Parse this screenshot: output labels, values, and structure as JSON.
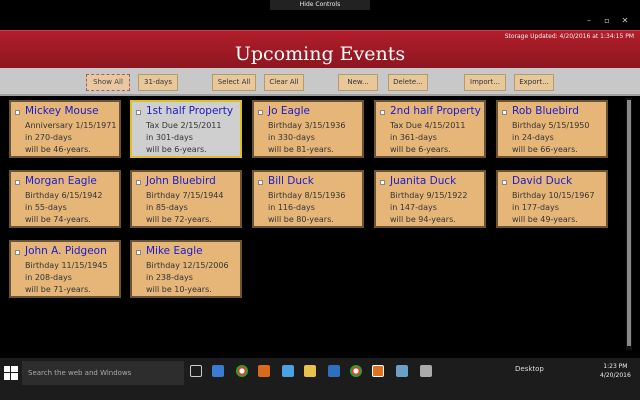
{
  "window": {
    "hide_controls": "Hide Controls",
    "storage_status": "Storage Updated: 4/20/2016 at 1:34:15 PM",
    "minimize": "–",
    "maximize": "▫",
    "close": "✕"
  },
  "header": {
    "title": "Upcoming Events"
  },
  "toolbar": {
    "show_all": "Show All",
    "days31": "31-days",
    "select_all": "Select All",
    "clear_all": "Clear All",
    "new": "New...",
    "delete": "Delete...",
    "import": "Import...",
    "export": "Export..."
  },
  "events": [
    {
      "name": "Mickey Mouse",
      "l1": "Anniversary 1/15/1971",
      "l2": "in 270-days",
      "l3": "will be 46-years."
    },
    {
      "name": "1st half Property",
      "l1": "Tax Due 2/15/2011",
      "l2": "in 301-days",
      "l3": "will be 6-years."
    },
    {
      "name": "Jo Eagle",
      "l1": "Birthday 3/15/1936",
      "l2": "in 330-days",
      "l3": "will be 81-years."
    },
    {
      "name": "2nd half Property",
      "l1": "Tax Due 4/15/2011",
      "l2": "in 361-days",
      "l3": "will be 6-years."
    },
    {
      "name": "Rob Bluebird",
      "l1": "Birthday 5/15/1950",
      "l2": "in 24-days",
      "l3": "will be 66-years."
    },
    {
      "name": "Morgan Eagle",
      "l1": "Birthday 6/15/1942",
      "l2": "in 55-days",
      "l3": "will be 74-years."
    },
    {
      "name": "John Bluebird",
      "l1": "Birthday 7/15/1944",
      "l2": "in 85-days",
      "l3": "will be 72-years."
    },
    {
      "name": "Bill Duck",
      "l1": "Birthday 8/15/1936",
      "l2": "in 116-days",
      "l3": "will be 80-years."
    },
    {
      "name": "Juanita Duck",
      "l1": "Birthday 9/15/1922",
      "l2": "in 147-days",
      "l3": "will be 94-years."
    },
    {
      "name": "David Duck",
      "l1": "Birthday 10/15/1967",
      "l2": "in 177-days",
      "l3": "will be 49-years."
    },
    {
      "name": "John A. Pidgeon",
      "l1": "Birthday 11/15/1945",
      "l2": "in 208-days",
      "l3": "will be 71-years."
    },
    {
      "name": "Mike Eagle",
      "l1": "Birthday 12/15/2006",
      "l2": "in 238-days",
      "l3": "will be 10-years."
    }
  ],
  "taskbar": {
    "search_placeholder": "Search the web and Windows",
    "desktop": "Desktop",
    "time": "1:23 PM",
    "date": "4/20/2016"
  },
  "colors": {
    "header": "#a01c26",
    "card": "#e6b679",
    "card_selected": "#cfcfcf",
    "name_link": "#1a1acc"
  }
}
